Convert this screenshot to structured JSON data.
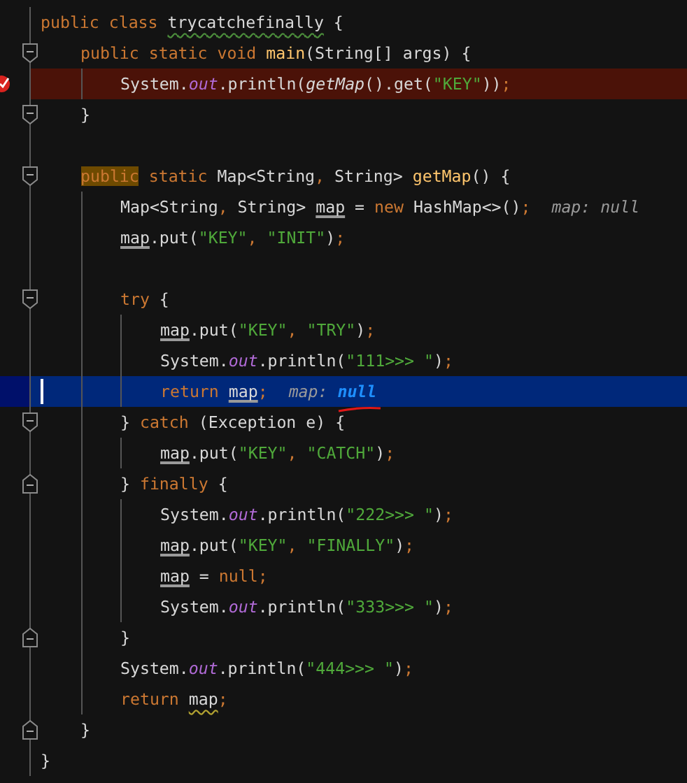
{
  "editor": {
    "lines": [
      {
        "kind": "code",
        "tokens": [
          {
            "kind": "kw",
            "text": "public class "
          },
          {
            "kind": "typo",
            "text": "trycatchefinally"
          },
          {
            "kind": "plain",
            "text": " {"
          }
        ],
        "children": [
          {
            "kind": "code",
            "fold_open": true,
            "tokens": [
              {
                "kind": "kw",
                "text": "public static void "
              },
              {
                "kind": "method",
                "text": "main"
              },
              {
                "kind": "plain",
                "text": "(String[] args) {"
              }
            ],
            "children": [
              {
                "kind": "code",
                "breakpoint": true,
                "tokens": [
                  {
                    "kind": "plain",
                    "text": "System."
                  },
                  {
                    "kind": "field",
                    "text": "out"
                  },
                  {
                    "kind": "plain",
                    "text": ".println("
                  },
                  {
                    "kind": "italic",
                    "text": "getMap"
                  },
                  {
                    "kind": "plain",
                    "text": "().get("
                  },
                  {
                    "kind": "str",
                    "text": "\"KEY\""
                  },
                  {
                    "kind": "plain",
                    "text": "))"
                  },
                  {
                    "kind": "punct",
                    "text": ";"
                  }
                ]
              }
            ]
          },
          {
            "kind": "code",
            "fold_open": true,
            "tokens": [
              {
                "kind": "plain",
                "text": "}"
              }
            ]
          },
          {
            "kind": "blank"
          },
          {
            "kind": "code",
            "fold_open": true,
            "tokens": [
              {
                "kind": "kw-marked",
                "text": "public"
              },
              {
                "kind": "kw",
                "text": " static "
              },
              {
                "kind": "plain",
                "text": "Map<String"
              },
              {
                "kind": "punct",
                "text": ","
              },
              {
                "kind": "plain",
                "text": " String> "
              },
              {
                "kind": "method",
                "text": "getMap"
              },
              {
                "kind": "plain",
                "text": "() {"
              }
            ],
            "children": [
              {
                "kind": "code",
                "tokens": [
                  {
                    "kind": "plain",
                    "text": "Map<String"
                  },
                  {
                    "kind": "punct",
                    "text": ","
                  },
                  {
                    "kind": "plain",
                    "text": " String> "
                  },
                  {
                    "kind": "var",
                    "text": "map"
                  },
                  {
                    "kind": "plain",
                    "text": " = "
                  },
                  {
                    "kind": "kw",
                    "text": "new "
                  },
                  {
                    "kind": "plain",
                    "text": "HashMap<>()"
                  },
                  {
                    "kind": "punct",
                    "text": ";"
                  }
                ],
                "hint": {
                  "label": "map:",
                  "value": "null",
                  "emphasis": false
                }
              },
              {
                "kind": "code",
                "tokens": [
                  {
                    "kind": "var",
                    "text": "map"
                  },
                  {
                    "kind": "plain",
                    "text": ".put("
                  },
                  {
                    "kind": "str",
                    "text": "\"KEY\""
                  },
                  {
                    "kind": "punct",
                    "text": ", "
                  },
                  {
                    "kind": "str",
                    "text": "\"INIT\""
                  },
                  {
                    "kind": "plain",
                    "text": ")"
                  },
                  {
                    "kind": "punct",
                    "text": ";"
                  }
                ]
              },
              {
                "kind": "blank"
              },
              {
                "kind": "code",
                "fold_open": true,
                "tokens": [
                  {
                    "kind": "kw",
                    "text": "try "
                  },
                  {
                    "kind": "plain",
                    "text": "{"
                  }
                ],
                "children": [
                  {
                    "kind": "code",
                    "tokens": [
                      {
                        "kind": "var",
                        "text": "map"
                      },
                      {
                        "kind": "plain",
                        "text": ".put("
                      },
                      {
                        "kind": "str",
                        "text": "\"KEY\""
                      },
                      {
                        "kind": "punct",
                        "text": ", "
                      },
                      {
                        "kind": "str",
                        "text": "\"TRY\""
                      },
                      {
                        "kind": "plain",
                        "text": ")"
                      },
                      {
                        "kind": "punct",
                        "text": ";"
                      }
                    ]
                  },
                  {
                    "kind": "code",
                    "tokens": [
                      {
                        "kind": "plain",
                        "text": "System."
                      },
                      {
                        "kind": "field",
                        "text": "out"
                      },
                      {
                        "kind": "plain",
                        "text": ".println("
                      },
                      {
                        "kind": "str",
                        "text": "\"111>>> \""
                      },
                      {
                        "kind": "plain",
                        "text": ")"
                      },
                      {
                        "kind": "punct",
                        "text": ";"
                      }
                    ]
                  },
                  {
                    "kind": "code",
                    "current": true,
                    "tokens": [
                      {
                        "kind": "kw",
                        "text": "return "
                      },
                      {
                        "kind": "var",
                        "text": "map"
                      },
                      {
                        "kind": "punct",
                        "text": ";"
                      }
                    ],
                    "hint": {
                      "label": "map:",
                      "value": "null",
                      "emphasis": true,
                      "marked": true
                    }
                  }
                ]
              },
              {
                "kind": "code",
                "fold_open": true,
                "tokens": [
                  {
                    "kind": "plain",
                    "text": "} "
                  },
                  {
                    "kind": "kw",
                    "text": "catch "
                  },
                  {
                    "kind": "plain",
                    "text": "(Exception e) {"
                  }
                ],
                "children": [
                  {
                    "kind": "code",
                    "tokens": [
                      {
                        "kind": "var",
                        "text": "map"
                      },
                      {
                        "kind": "plain",
                        "text": ".put("
                      },
                      {
                        "kind": "str",
                        "text": "\"KEY\""
                      },
                      {
                        "kind": "punct",
                        "text": ", "
                      },
                      {
                        "kind": "str",
                        "text": "\"CATCH\""
                      },
                      {
                        "kind": "plain",
                        "text": ")"
                      },
                      {
                        "kind": "punct",
                        "text": ";"
                      }
                    ]
                  }
                ]
              },
              {
                "kind": "code",
                "fold_close": true,
                "tokens": [
                  {
                    "kind": "plain",
                    "text": "} "
                  },
                  {
                    "kind": "kw",
                    "text": "finally "
                  },
                  {
                    "kind": "plain",
                    "text": "{"
                  }
                ],
                "children": [
                  {
                    "kind": "code",
                    "tokens": [
                      {
                        "kind": "plain",
                        "text": "System."
                      },
                      {
                        "kind": "field",
                        "text": "out"
                      },
                      {
                        "kind": "plain",
                        "text": ".println("
                      },
                      {
                        "kind": "str",
                        "text": "\"222>>> \""
                      },
                      {
                        "kind": "plain",
                        "text": ")"
                      },
                      {
                        "kind": "punct",
                        "text": ";"
                      }
                    ]
                  },
                  {
                    "kind": "code",
                    "tokens": [
                      {
                        "kind": "var",
                        "text": "map"
                      },
                      {
                        "kind": "plain",
                        "text": ".put("
                      },
                      {
                        "kind": "str",
                        "text": "\"KEY\""
                      },
                      {
                        "kind": "punct",
                        "text": ", "
                      },
                      {
                        "kind": "str",
                        "text": "\"FINALLY\""
                      },
                      {
                        "kind": "plain",
                        "text": ")"
                      },
                      {
                        "kind": "punct",
                        "text": ";"
                      }
                    ]
                  },
                  {
                    "kind": "code",
                    "tokens": [
                      {
                        "kind": "var",
                        "text": "map"
                      },
                      {
                        "kind": "plain",
                        "text": " = "
                      },
                      {
                        "kind": "kw",
                        "text": "null"
                      },
                      {
                        "kind": "punct",
                        "text": ";"
                      }
                    ]
                  },
                  {
                    "kind": "code",
                    "tokens": [
                      {
                        "kind": "plain",
                        "text": "System."
                      },
                      {
                        "kind": "field",
                        "text": "out"
                      },
                      {
                        "kind": "plain",
                        "text": ".println("
                      },
                      {
                        "kind": "str",
                        "text": "\"333>>> \""
                      },
                      {
                        "kind": "plain",
                        "text": ")"
                      },
                      {
                        "kind": "punct",
                        "text": ";"
                      }
                    ]
                  }
                ]
              },
              {
                "kind": "code",
                "fold_close": true,
                "tokens": [
                  {
                    "kind": "plain",
                    "text": "}"
                  }
                ]
              },
              {
                "kind": "code",
                "tokens": [
                  {
                    "kind": "plain",
                    "text": "System."
                  },
                  {
                    "kind": "field",
                    "text": "out"
                  },
                  {
                    "kind": "plain",
                    "text": ".println("
                  },
                  {
                    "kind": "str",
                    "text": "\"444>>> \""
                  },
                  {
                    "kind": "plain",
                    "text": ")"
                  },
                  {
                    "kind": "punct",
                    "text": ";"
                  }
                ]
              },
              {
                "kind": "code",
                "tokens": [
                  {
                    "kind": "kw",
                    "text": "return "
                  },
                  {
                    "kind": "warn",
                    "text": "map"
                  },
                  {
                    "kind": "punct",
                    "text": ";"
                  }
                ]
              }
            ]
          },
          {
            "kind": "code",
            "fold_close": true,
            "tokens": [
              {
                "kind": "plain",
                "text": "}"
              }
            ]
          }
        ]
      },
      {
        "kind": "code",
        "tokens": [
          {
            "kind": "plain",
            "text": "}"
          }
        ]
      }
    ]
  }
}
